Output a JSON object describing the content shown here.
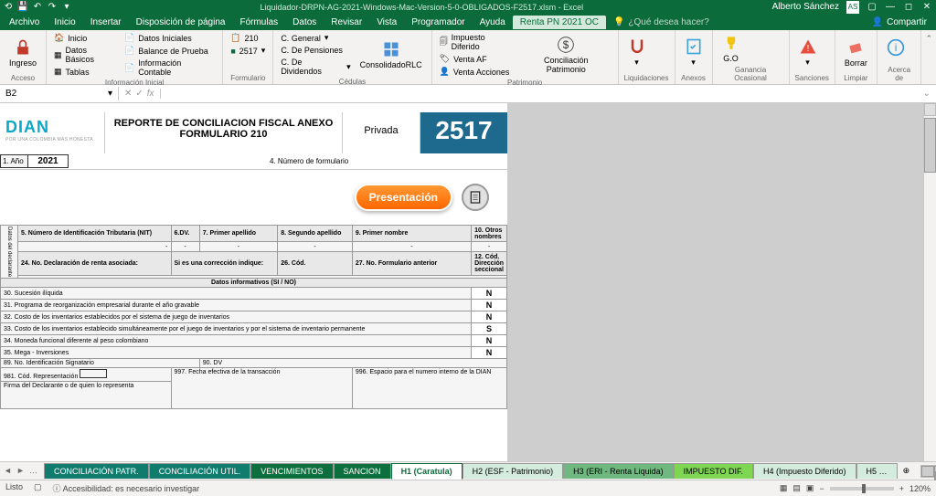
{
  "titlebar": {
    "filename": "Liquidador-DRPN-AG-2021-Windows-Mac-Version-5-0-OBLIGADOS-F2517.xlsm - Excel",
    "user": "Alberto Sánchez",
    "user_initials": "AS"
  },
  "menu": {
    "items": [
      "Archivo",
      "Inicio",
      "Insertar",
      "Disposición de página",
      "Fórmulas",
      "Datos",
      "Revisar",
      "Vista",
      "Programador",
      "Ayuda",
      "Renta PN 2021 OC"
    ],
    "active_index": 10,
    "tellme": "¿Qué desea hacer?",
    "share": "Compartir"
  },
  "ribbon": {
    "group_acceso": {
      "label": "Acceso",
      "ingreso": "Ingreso"
    },
    "group_info": {
      "label": "Información Inicial",
      "inicio": "Inicio",
      "datos_basicos": "Datos Básicos",
      "tablas": "Tablas",
      "datos_iniciales": "Datos Iniciales",
      "balance_prueba": "Balance de Prueba",
      "info_contable": "Información Contable"
    },
    "group_formulario": {
      "label": "Formulario",
      "r210": "210",
      "r2517": "2517"
    },
    "group_cedulas": {
      "label": "Cédulas",
      "general": "C. General",
      "pensiones": "C. De Pensiones",
      "dividendos": "C. De Dividendos",
      "consolidado": "ConsolidadoRLC"
    },
    "group_patrimonio": {
      "label": "Patrimonio",
      "impuesto_diferido": "Impuesto Diferido",
      "venta_af": "Venta AF",
      "venta_acciones": "Venta Acciones",
      "conciliacion": "Conciliación Patrimonio"
    },
    "group_liquidaciones": {
      "label": "Liquidaciones"
    },
    "group_anexos": {
      "label": "Anexos"
    },
    "group_go": {
      "label": "Ganancia Ocasional",
      "go": "G.O"
    },
    "group_sanciones": {
      "label": "Sanciones"
    },
    "group_limpiar": {
      "label": "Limpiar",
      "borrar": "Borrar"
    },
    "group_acerca": {
      "label": "Acerca de"
    }
  },
  "formula_bar": {
    "cell_ref": "B2",
    "fx": "fx",
    "value": ""
  },
  "form": {
    "dian": "DIAN",
    "dian_sub": "POR UNA COLOMBIA MÁS HONESTA",
    "title_l1": "REPORTE DE CONCILIACION FISCAL ANEXO",
    "title_l2": "FORMULARIO 210",
    "privada": "Privada",
    "num": "2517",
    "year_label": "1. Año",
    "year": "2021",
    "num_form_label": "4. Número de formulario",
    "btn_presentacion": "Presentación",
    "headers": {
      "rotated": "Datos del declarante",
      "h5": "5. Número de Identificación Tributaria (NIT)",
      "h6": "6.DV.",
      "h7": "7. Primer apellido",
      "h8": "8. Segundo apellido",
      "h9": "9. Primer nombre",
      "h10": "10. Otros nombres",
      "h24": "24. No. Declaración de renta asociada:",
      "h24b": "Si es una corrección indique:",
      "h26": "26. Cód.",
      "h27": "27. No. Formulario anterior",
      "h12": "12. Cód. Dirección seccional",
      "datos_info": "Datos informativos (SI / NO)"
    },
    "rows": [
      {
        "label": "30. Sucesión ilíquida",
        "val": "N"
      },
      {
        "label": "31. Programa de reorganización empresarial durante el año gravable",
        "val": "N"
      },
      {
        "label": "32. Costo de los inventarios establecidos por el sistema de juego de inventarios",
        "val": "N"
      },
      {
        "label": "33. Costo de los inventarios establecido simultáneamente por el juego de inventarios y por el sistema de inventario permanente",
        "val": "S"
      },
      {
        "label": "34. Moneda funcional diferente al peso colombiano",
        "val": "N"
      },
      {
        "label": "35. Mega - Inversiones",
        "val": "N"
      }
    ],
    "footer": {
      "r89": "89. No. Identificación Signatario",
      "r90": "90. DV",
      "r981": "981. Cód. Representación",
      "firma": "Firma del Declarante o de quien lo representa",
      "r997": "997. Fecha efectiva de la transacción",
      "r996": "996. Espacio para el numero interno de la DIAN"
    }
  },
  "tabs": [
    {
      "label": "CONCILIACIÓN PATR.",
      "cls": "t-teal"
    },
    {
      "label": "CONCILIACIÓN UTIL.",
      "cls": "t-teal"
    },
    {
      "label": "VENCIMIENTOS",
      "cls": "t-green"
    },
    {
      "label": "SANCION",
      "cls": "t-green"
    },
    {
      "label": "H1 (Caratula)",
      "cls": "t-white"
    },
    {
      "label": "H2 (ESF - Patrimonio)",
      "cls": "t-lgreen"
    },
    {
      "label": "H3 (ERI - Renta Liquida)",
      "cls": "t-mgreen"
    },
    {
      "label": "IMPUESTO DIF.",
      "cls": "t-lime"
    },
    {
      "label": "H4 (Impuesto Diferido)",
      "cls": "t-lgreen"
    },
    {
      "label": "H5 …",
      "cls": "t-lgreen"
    }
  ],
  "status": {
    "ready": "Listo",
    "accessibility": "Accesibilidad: es necesario investigar",
    "zoom": "120%"
  }
}
